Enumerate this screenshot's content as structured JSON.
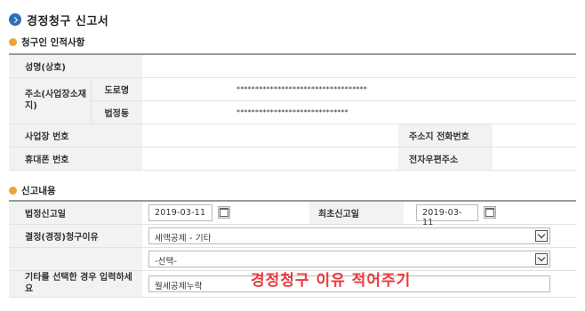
{
  "page_title": "경정청구 신고서",
  "section1": {
    "title": "청구인 인적사항",
    "name_label": "성명(상호)",
    "address_label": "주소(사업장소재지)",
    "road_label": "도로명",
    "road_value": "***********************************",
    "lot_label": "법정동",
    "lot_value": "******************************",
    "bizno_label": "사업장 번호",
    "phone_label": "주소지 전화번호",
    "mobile_label": "휴대폰 번호",
    "email_label": "전자우편주소"
  },
  "section2": {
    "title": "신고내용",
    "legal_date_label": "법정신고일",
    "legal_date_value": "2019-03-11",
    "first_date_label": "최초신고일",
    "first_date_value": "2019-03-11",
    "reason_label": "결정(경정)청구이유",
    "reason_select_value": "세액공제 - 기타",
    "reason_sub_select_value": "-선택-",
    "other_label": "기타를 선택한 경우 입력하세요",
    "other_value": "월세공제누락"
  },
  "annotation": "경정청구 이유 적어주기",
  "colors": {
    "title_icon": "#2f6fb6",
    "section_dot": "#f0a23a",
    "annotation": "#e8393e",
    "header_bg": "#f2f2f2"
  }
}
